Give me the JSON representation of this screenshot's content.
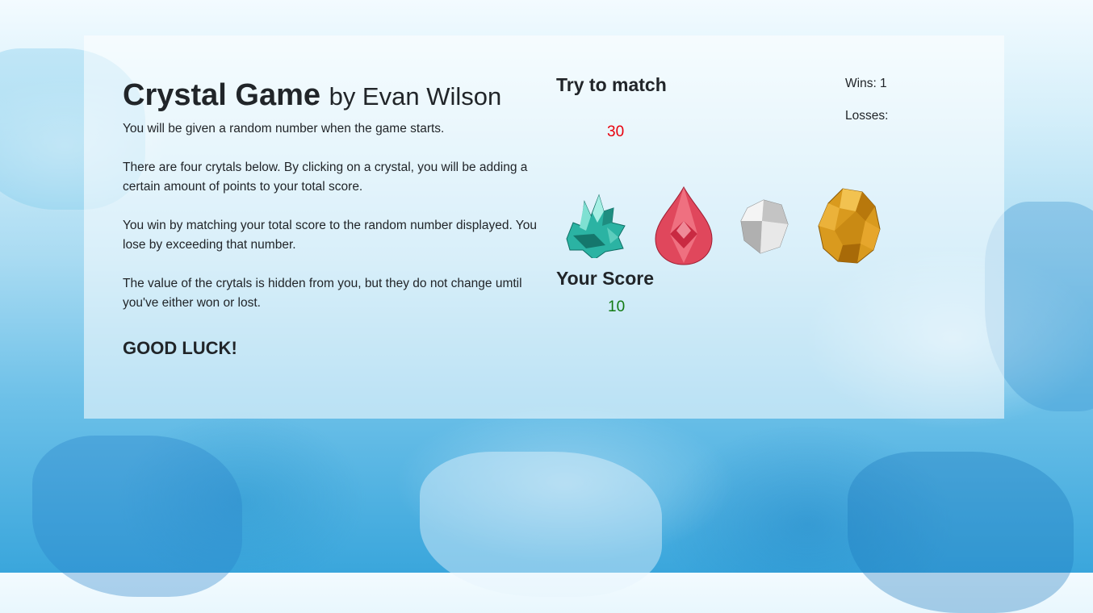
{
  "header": {
    "title": "Crystal Game",
    "byline": "by Evan Wilson"
  },
  "instructions": {
    "p1": "You will be given a random number when the game starts.",
    "p2": "There are four crytals below. By clicking on a crystal, you will be adding a certain amount of points to your total score.",
    "p3": "You win by matching your total score to the random number displayed. You lose by exceeding that number.",
    "p4": "The value of the crytals is hidden from you, but they do not change umtil you've either won or lost.",
    "closing": "GOOD LUCK!"
  },
  "game": {
    "match_label": "Try to match",
    "target_number": "30",
    "score_label": "Your Score",
    "score_value": "10",
    "crystals": [
      {
        "name": "teal-crystal",
        "color": "#2bb3a3"
      },
      {
        "name": "pink-teardrop-gem",
        "color": "#e0475c"
      },
      {
        "name": "clear-diamond",
        "color": "#d8d8d8"
      },
      {
        "name": "amber-crystal",
        "color": "#d99a1e"
      }
    ]
  },
  "stats": {
    "wins_label": "Wins: 1",
    "losses_label": "Losses:"
  },
  "colors": {
    "target": "#e8000d",
    "score": "#127a12"
  }
}
